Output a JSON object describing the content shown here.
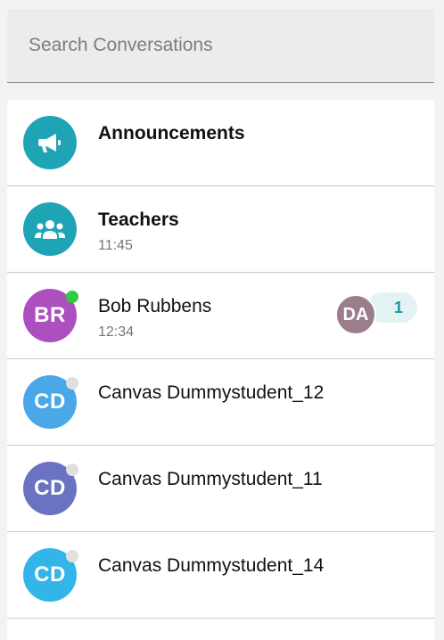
{
  "search": {
    "placeholder": "Search Conversations"
  },
  "colors": {
    "teal": "#1fa4b5",
    "purple": "#ae4fc0",
    "blue": "#4aa8e8",
    "indigo": "#6a72c2",
    "sky": "#33b5ea",
    "online": "#2ecc40",
    "offline": "#e0e0e0"
  },
  "conversations": [
    {
      "name": "Announcements",
      "bold": true,
      "icon": "megaphone-icon"
    },
    {
      "name": "Teachers",
      "bold": true,
      "time": "11:45",
      "icon": "group-icon"
    },
    {
      "name": "Bob Rubbens",
      "time": "12:34",
      "initials": "BR",
      "presence": "online",
      "participant_initials": "DA",
      "unread": "1"
    },
    {
      "name": "Canvas Dummystudent_12",
      "initials": "CD",
      "presence": "offline"
    },
    {
      "name": "Canvas Dummystudent_11",
      "initials": "CD",
      "presence": "offline"
    },
    {
      "name": "Canvas Dummystudent_14",
      "initials": "CD",
      "presence": "offline"
    }
  ]
}
